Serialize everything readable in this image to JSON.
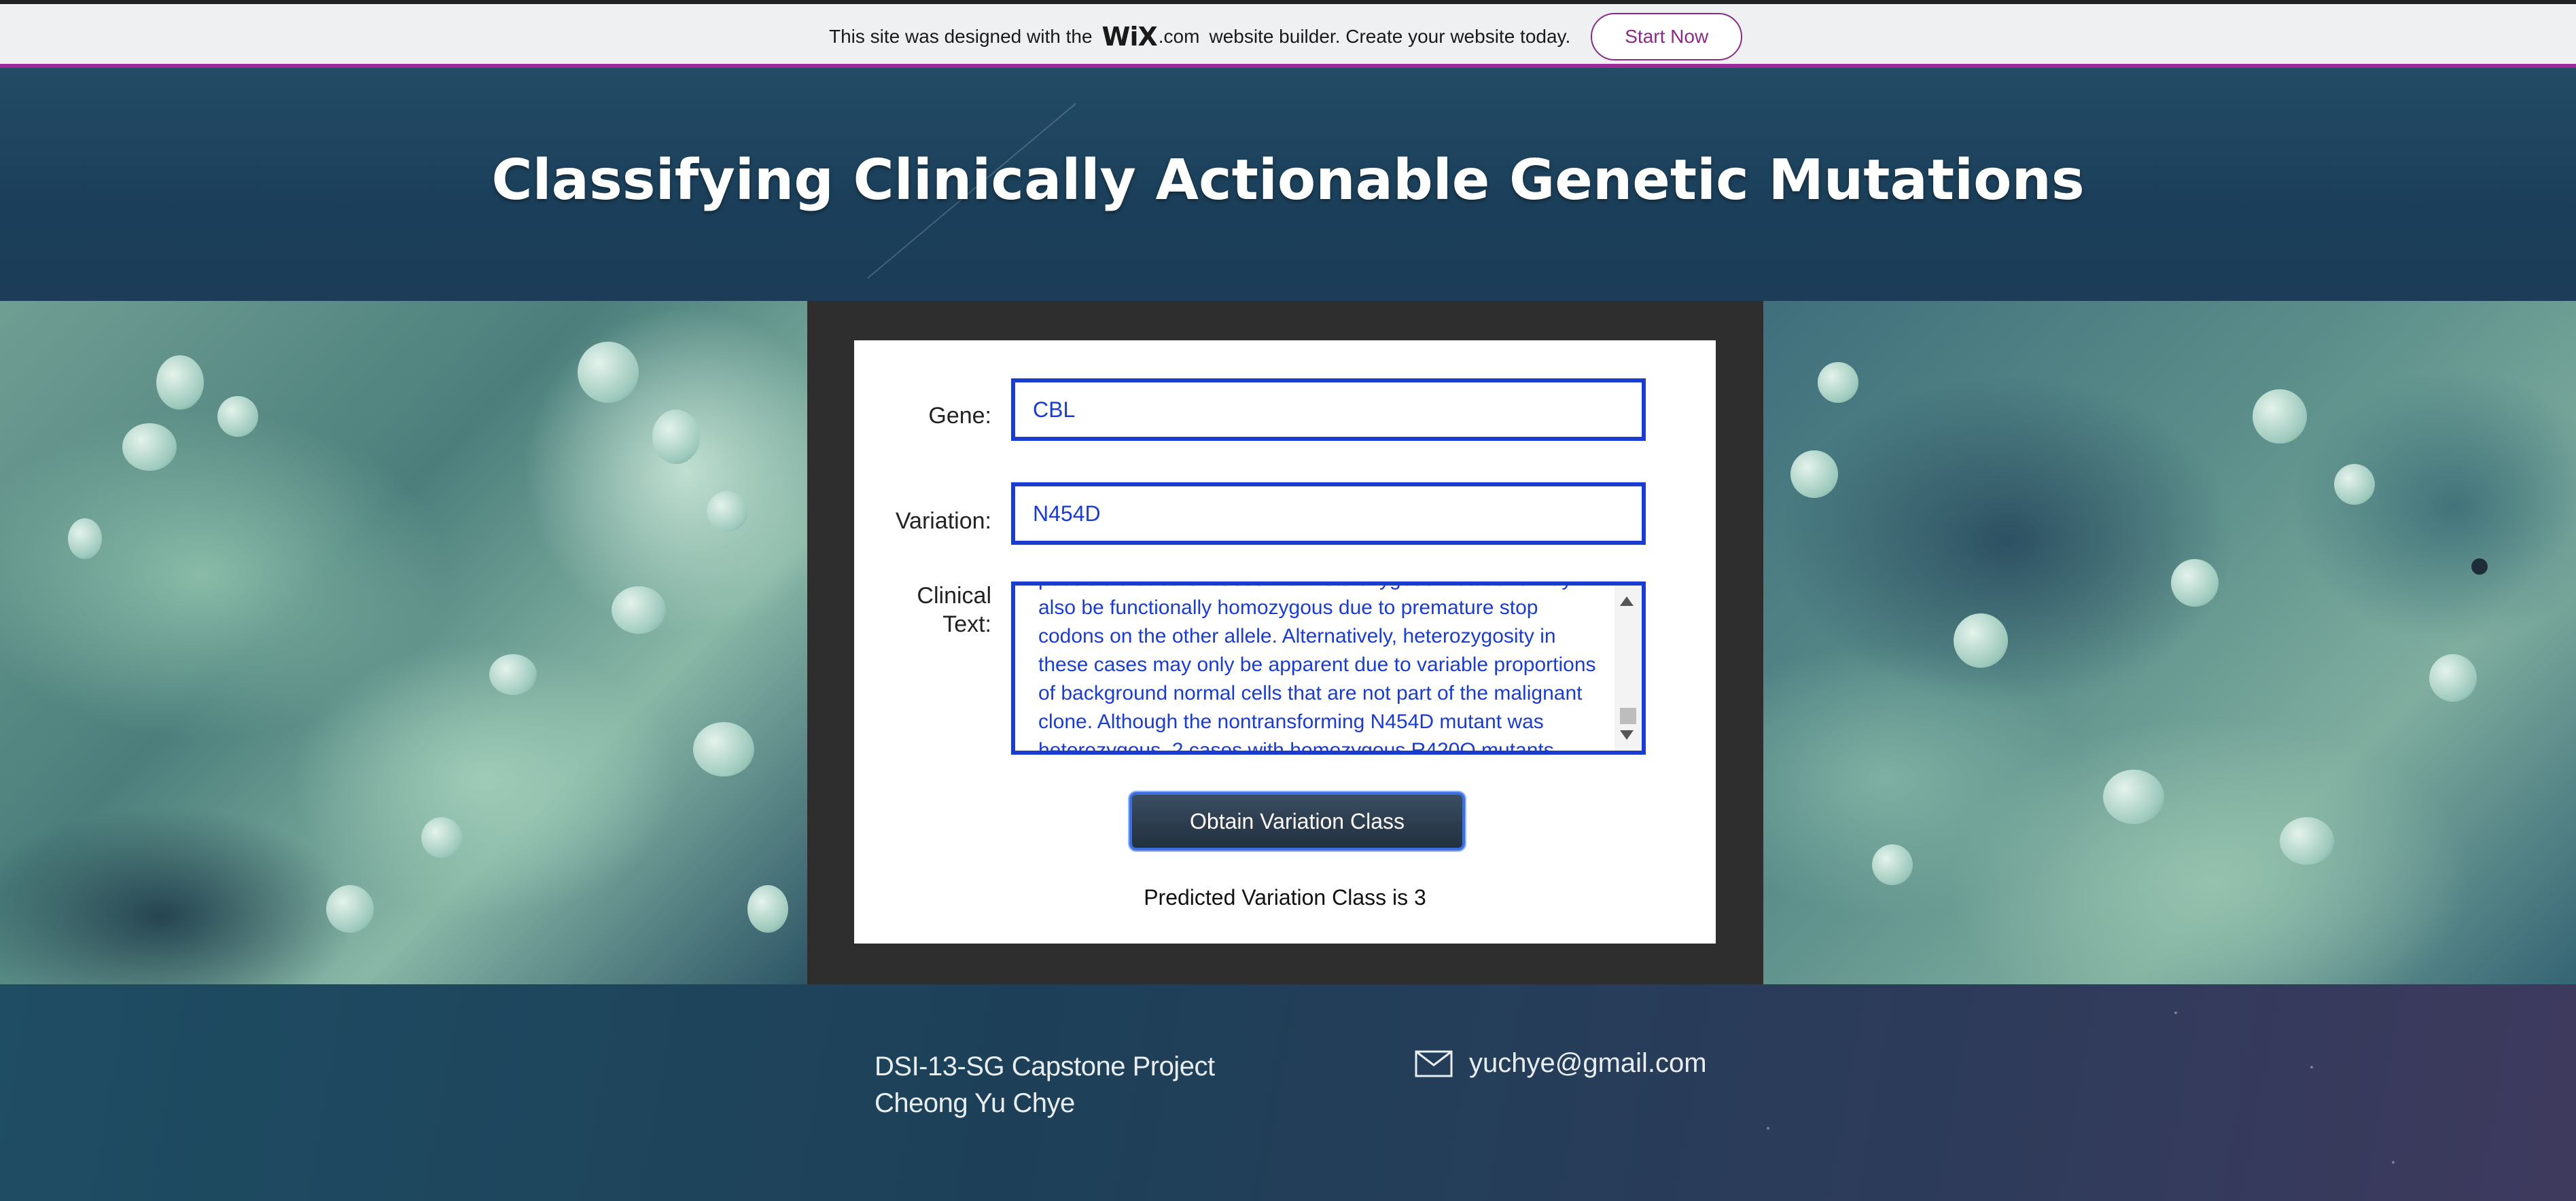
{
  "banner": {
    "text_before": "This site was designed with the",
    "logo": "WiX",
    "logo_suffix": ".com",
    "text_after": "website builder. Create your website today.",
    "button_label": "Start Now"
  },
  "header": {
    "title": "Classifying Clinically Actionable Genetic Mutations"
  },
  "form": {
    "gene_label": "Gene:",
    "gene_value": "CBL",
    "variation_label": "Variation:",
    "variation_value": "N454D",
    "clinical_label_1": "Clinical",
    "clinical_label_2": "Text:",
    "clinical_text": "possible that other cases with heterozygous mutations may also be functionally homozygous due to premature stop codons on the other allele. Alternatively, heterozygosity in these cases may only be apparent due to variable proportions of background normal cells that are not part of the malignant clone. Although the nontransforming N454D mutant was heterozygous, 2 cases with homozygous R420Q mutants showed this to be one of",
    "button_label": "Obtain Variation Class",
    "result": "Predicted Variation Class is 3"
  },
  "footer": {
    "project": "DSI-13-SG Capstone Project",
    "author": "Cheong Yu Chye",
    "email": "yuchye@gmail.com",
    "email_icon": "mail-icon"
  },
  "colors": {
    "accent": "#1a3ccf",
    "wix_purple": "#8a2b86",
    "panel": "#2e2e2e"
  }
}
